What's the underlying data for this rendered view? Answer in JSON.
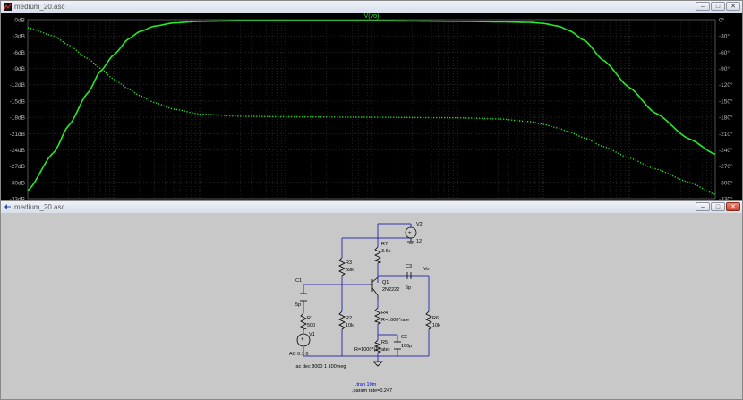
{
  "plot_window": {
    "title": "medium_20.asc",
    "buttons": {
      "minimize": "–",
      "restore": "□",
      "close": "✕"
    }
  },
  "schematic_window": {
    "title": "medium_20.asc",
    "buttons": {
      "minimize": "–",
      "restore": "□",
      "close": "✕"
    }
  },
  "chart_data": {
    "type": "line",
    "title": "V(vo)",
    "x_scale": "log",
    "x_ticks": [
      "1Hz",
      "10Hz",
      "100Hz",
      "1KHz",
      "10KHz",
      "100KHz",
      "1MHz",
      "10MHz"
    ],
    "x_tick_values": [
      1,
      10,
      100,
      1000,
      10000,
      100000,
      1000000,
      10000000
    ],
    "xlim": [
      1,
      100000000
    ],
    "y_left_ticks": [
      "0dB",
      "-3dB",
      "-6dB",
      "-9dB",
      "-12dB",
      "-15dB",
      "-18dB",
      "-21dB",
      "-24dB",
      "-27dB",
      "-30dB",
      "-33dB"
    ],
    "ylim_left": [
      -33,
      0
    ],
    "y_right_ticks": [
      "0°",
      "-30°",
      "-60°",
      "-90°",
      "-120°",
      "-150°",
      "-180°",
      "-210°",
      "-240°",
      "-270°",
      "-300°",
      "-330°"
    ],
    "ylim_right": [
      -330,
      0
    ],
    "grid": true,
    "colors": {
      "trace": "#22ee22",
      "background": "#000000",
      "grid": "#4a4a4a",
      "axis_text": "#b8b8b8"
    },
    "series": [
      {
        "name": "V(vo)",
        "axis": "magnitude_dB",
        "style": "solid",
        "x": [
          1,
          2,
          3,
          5,
          7,
          10,
          15,
          20,
          30,
          50,
          100,
          300,
          1000,
          10000,
          100000,
          300000,
          700000,
          1000000,
          1500000,
          2000000,
          3000000,
          5000000,
          10000000,
          20000000,
          50000000,
          100000000
        ],
        "y": [
          -31.5,
          -24.5,
          -19.5,
          -13.5,
          -9.5,
          -6.5,
          -3.5,
          -2.2,
          -1.2,
          -0.6,
          -0.3,
          -0.2,
          -0.2,
          -0.2,
          -0.3,
          -0.4,
          -0.5,
          -0.7,
          -1.2,
          -2.0,
          -3.8,
          -7.5,
          -12.5,
          -17.2,
          -22,
          -24.8
        ]
      },
      {
        "name": "V(vo)",
        "axis": "phase_deg",
        "style": "dotted",
        "x": [
          1,
          2,
          3,
          5,
          7,
          10,
          15,
          20,
          30,
          50,
          100,
          300,
          1000,
          10000,
          100000,
          300000,
          700000,
          1000000,
          1500000,
          2000000,
          3000000,
          5000000,
          10000000,
          20000000,
          50000000,
          100000000
        ],
        "y": [
          -15,
          -30,
          -47,
          -72,
          -90,
          -110,
          -128,
          -140,
          -153,
          -165,
          -174,
          -178,
          -179,
          -180,
          -181,
          -183,
          -188,
          -193,
          -200,
          -207,
          -218,
          -234,
          -255,
          -275,
          -300,
          -322
        ]
      }
    ]
  },
  "schematic": {
    "nodes": {
      "vo": "Vo",
      "v2": "V2",
      "v2_value": "12",
      "r7": "R7",
      "r7_value": "3.6k",
      "r3": "R3",
      "r3_value": "39k",
      "c3": "C3",
      "c3_value": "5p",
      "c1": "C1",
      "c1_value": "5p",
      "q1": "Q1",
      "q1_value": "2N2222",
      "r1": "R1",
      "r1_value": "500",
      "r2": "R2",
      "r2_value": "10k",
      "r4": "R4",
      "r4_value": "R=1000*rate",
      "r6": "R6",
      "r6_value": "10k",
      "v1": "V1",
      "v1_value": "AC 0.1 0",
      "c2": "C2",
      "c2_value": "100p",
      "r5": "R5",
      "r5_value": "R=1000*(1-rate)",
      "ac_directive": ".ac dec 8000 1 100meg",
      "tran_directive": ".tran 10m",
      "param_directive": ".param rate=0.247"
    },
    "colors": {
      "wire": "#3333aa",
      "component": "#000000",
      "directive": "#0000cc",
      "background": "#c8c8c8"
    }
  }
}
